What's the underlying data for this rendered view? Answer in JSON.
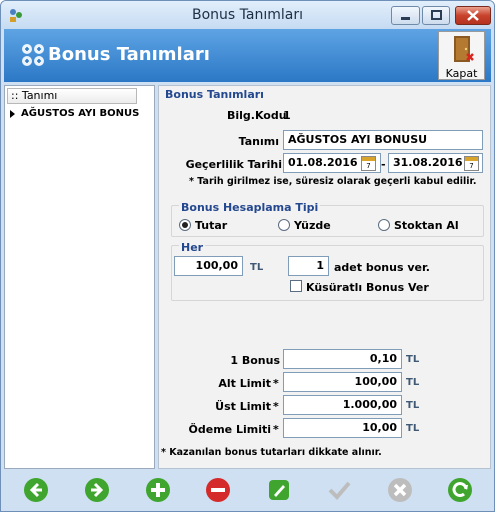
{
  "window": {
    "title": "Bonus Tanımları"
  },
  "banner": {
    "title": "Bonus Tanımları"
  },
  "close_button": {
    "label": "Kapat"
  },
  "grid": {
    "column_header": "Tanımı",
    "rows": [
      "AĞUSTOS AYI BONUS"
    ]
  },
  "form": {
    "section_title": "Bonus Tanımları",
    "code_label": "Bilg.Kodu",
    "code_value": "1",
    "name_label": "Tanımı",
    "name_value": "AĞUSTOS AYI BONUSU",
    "validity_label": "Geçerlilik Tarihi",
    "date_from": "01.08.2016",
    "date_sep": "-",
    "date_to": "31.08.2016",
    "date_note": "* Tarih girilmez ise, süresiz olarak geçerli kabul edilir.",
    "calc_group_title": "Bonus Hesaplama Tipi",
    "radio_amount": "Tutar",
    "radio_percent": "Yüzde",
    "radio_stock": "Stoktan Al",
    "selected_calc": "Tutar",
    "per_group_title": "Her",
    "per_amount": "100,00",
    "per_qty": "1",
    "per_suffix": "adet bonus ver.",
    "fractional_label": "Küsüratlı Bonus Ver",
    "fractional_checked": false,
    "currency": "TL",
    "one_bonus_label": "1 Bonus",
    "one_bonus_value": "0,10",
    "min_limit_label": "Alt Limit",
    "min_limit_value": "100,00",
    "max_limit_label": "Üst Limit",
    "max_limit_value": "1.000,00",
    "pay_limit_label": "Ödeme Limiti",
    "pay_limit_value": "10,00",
    "required_mark": "*",
    "earnings_note": "* Kazanılan bonus tutarları dikkate alınır."
  },
  "toolbar": {
    "buttons": [
      "previous",
      "next",
      "add",
      "delete",
      "edit",
      "confirm",
      "cancel",
      "refresh"
    ]
  },
  "colors": {
    "banner": "#3b86d6",
    "green": "#3fa52e",
    "red": "#d52a2a",
    "disabled": "#bdbdbd"
  }
}
